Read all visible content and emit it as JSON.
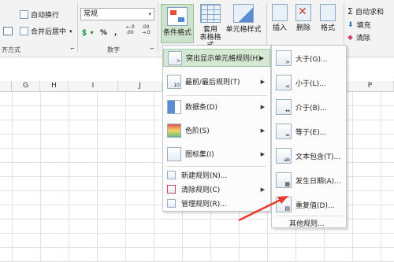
{
  "ribbon": {
    "alignment": {
      "wrap_text": "自动换行",
      "merge_center": "合并后居中",
      "merge_center_arrow": "▾",
      "group_label": "齐方式",
      "launcher": "⌐"
    },
    "number": {
      "format_value": "常规",
      "format_arrow": "▾",
      "accounting": "💲 ▾",
      "percent": "%",
      "comma": ",",
      "inc_decimal": "←.0 .00",
      "dec_decimal": ".00 →.0",
      "group_label": "数字",
      "launcher": "⌐"
    },
    "styles": {
      "conditional_format": "条件格式",
      "table_format_1": "套用",
      "table_format_2": "表格格式",
      "cell_style": "单元格样式"
    },
    "cells": {
      "insert": "插入",
      "delete": "删除",
      "format": "格式"
    },
    "editing": {
      "autosum": "自动求和",
      "fill": "填充",
      "clear": "清除"
    }
  },
  "columns": [
    "G",
    "H",
    "I",
    "J",
    "P"
  ],
  "menu1": {
    "items": [
      {
        "label": "突出显示单元格规则(H)",
        "has_sub": true
      },
      {
        "label": "最前/最后规则(T)",
        "has_sub": true
      },
      {
        "label": "数据条(D)",
        "has_sub": true
      },
      {
        "label": "色阶(S)",
        "has_sub": true
      },
      {
        "label": "图标集(I)",
        "has_sub": true
      },
      {
        "label": "新建规则(N)...",
        "has_sub": false
      },
      {
        "label": "清除规则(C)",
        "has_sub": true
      },
      {
        "label": "管理规则(R)...",
        "has_sub": false
      }
    ],
    "sub_arrow": "▶"
  },
  "menu2": {
    "items": [
      {
        "label": "大于(G)...",
        "icon": ">"
      },
      {
        "label": "小于(L)...",
        "icon": "<"
      },
      {
        "label": "介于(B)...",
        "icon": "↔"
      },
      {
        "label": "等于(E)...",
        "icon": "="
      },
      {
        "label": "文本包含(T)...",
        "icon": "ab"
      },
      {
        "label": "发生日期(A)...",
        "icon": "▦"
      },
      {
        "label": "重复值(D)...",
        "icon": "▤"
      }
    ],
    "more": "其他规则..."
  },
  "colors": {
    "highlight": "#d4e8d2",
    "arrow": "#e8392f"
  }
}
